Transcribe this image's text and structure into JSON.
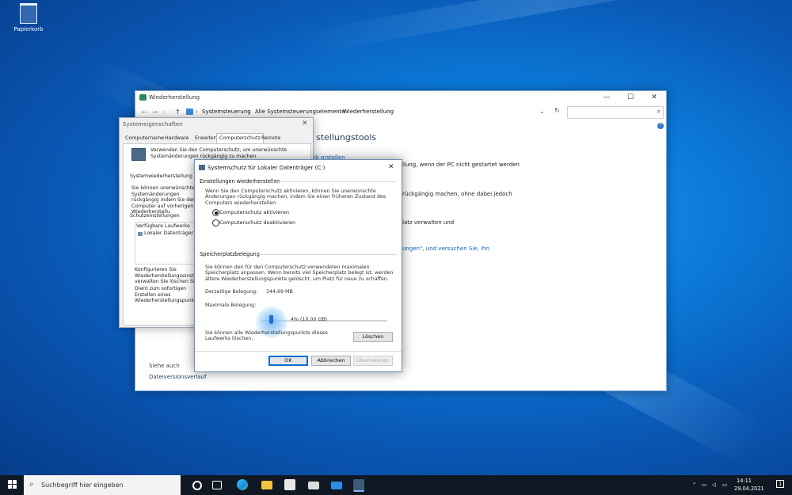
{
  "desktop": {
    "recycle_bin_label": "Papierkorb"
  },
  "explorer": {
    "title": "Wiederherstellung",
    "breadcrumb": [
      "Systemsteuerung",
      "Alle Systemsteuerungselemente",
      "Wiederherstellung"
    ],
    "heading": "stellungstools",
    "line1_link": "rk erstellen",
    "line1_text": "llung, wenn der PC nicht gestartet werden",
    "line2_text": "rückgängig machen, ohne dabei jedoch",
    "line3_text": "latz verwalten und",
    "line4_link": "ungen\", und versuchen Sie, ihn",
    "see_also": "Siehe auch",
    "file_history": "Dateiversionsverlauf"
  },
  "sysprop": {
    "title": "Systemeigenschaften",
    "tabs": [
      "Computername",
      "Hardware",
      "Erweitert",
      "Computerschutz",
      "Remote"
    ],
    "intro": "Verwenden Sie den Computerschutz, um unerwünschte Systemänderungen rückgängig zu machen.",
    "restore_header": "Systemwiederherstellung",
    "restore_text": "Sie können unerwünschte Systemänderungen rückgängig indem Sie den Computer auf vorherigen Wiederherstellu zurücksetzen.",
    "protection_header": "Schutzeinstellungen",
    "drives_header": "Verfügbare Laufwerke",
    "drive_item": "Lokaler Datenträger (C",
    "configure_text": "Konfigurieren Sie Wiederherstellungseinstellungen, verwalten Sie löschen Sie Wiederherstellungs",
    "create_text": "Dient zum sofortigen Erstellen eines Wiederherstellungspunkts für aktiviertem Systemschutz."
  },
  "dialog": {
    "title": "Systemschutz für Lokaler Datenträger (C:)",
    "restore_settings_header": "Einstellungen wiederherstellen",
    "restore_settings_text": "Wenn Sie den Computerschutz aktivieren, können Sie unerwünschte Änderungen rückgängig machen, indem Sie einen früheren Zustand des Computers wiederherstellen.",
    "radio_enable": "Computerschutz aktivieren",
    "radio_disable": "Computerschutz deaktivieren",
    "storage_header": "Speicherplatzbelegung",
    "storage_text": "Sie können den für den Computerschutz verwendeten maximalen Speicherplatz anpassen. Wenn bereits viel Speicherplatz belegt ist, werden ältere Wiederherstellungspunkte gelöscht, um Platz für neue zu schaffen.",
    "current_usage_label": "Derzeitige Belegung:",
    "current_usage_value": "344,69 MB",
    "max_usage_label": "Maximale Belegung:",
    "max_usage_percent": 4,
    "max_usage_value": "4% (10,00 GB)",
    "delete_text": "Sie können alle Wiederherstellungspunkte dieses Laufwerks löschen.",
    "delete_button": "Löschen",
    "ok_button": "OK",
    "cancel_button": "Abbrechen",
    "apply_button": "Übernehmen"
  },
  "taskbar": {
    "search_placeholder": "Suchbegriff hier eingeben",
    "time": "14:11",
    "date": "29.04.2021",
    "notifications_count": "1"
  }
}
